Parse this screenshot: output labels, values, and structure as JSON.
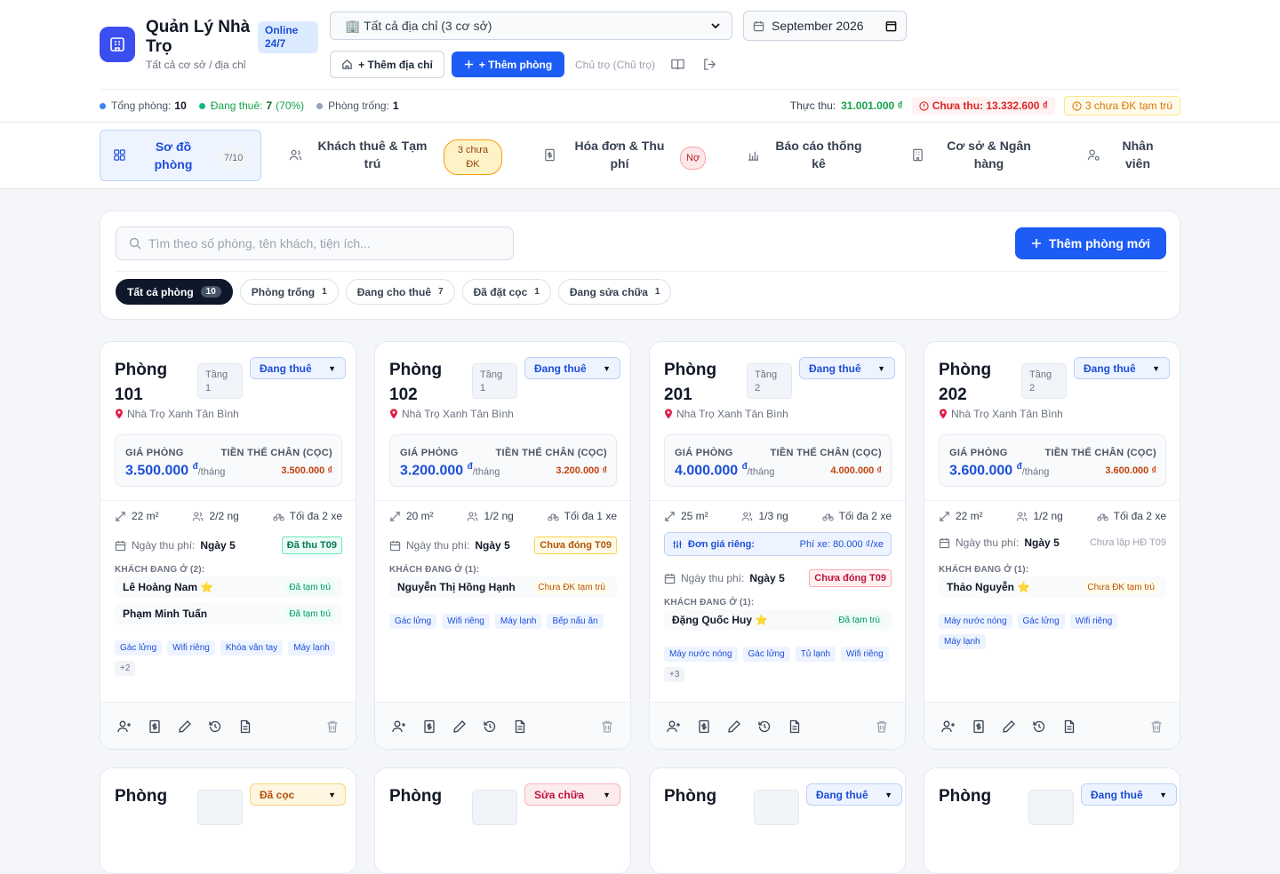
{
  "header": {
    "title": "Quản Lý Nhà Trọ",
    "subtitle": "Tất cả cơ sở / địa chỉ",
    "online_badge": "Online 24/7",
    "address_select": "🏢 Tất cả địa chỉ (3 cơ sở)",
    "month": "September 2026",
    "add_address_label": "+ Thêm địa chỉ",
    "add_room_label": "+ Thêm phòng",
    "owner": "Chủ trọ (Chủ trọ)"
  },
  "stats": {
    "total_label": "Tổng phòng:",
    "total_value": "10",
    "renting_label": "Đang thuê:",
    "renting_value": "7",
    "renting_pct": "(70%)",
    "empty_label": "Phòng trống:",
    "empty_value": "1",
    "collected_label": "Thực thu:",
    "collected_value": "31.001.000 ₫",
    "uncollected": "Chưa thu: 13.332.600 ₫",
    "unregistered": "3 chưa ĐK tạm trú",
    "colors": {
      "total": "#3b82f6",
      "renting": "#10b981",
      "empty": "#94a3b8"
    }
  },
  "tabs": [
    {
      "label": "Sơ đồ phòng",
      "count": "7/10",
      "icon": "grid-icon"
    },
    {
      "label": "Khách thuê & Tạm trú",
      "badge": "3 chưa ĐK",
      "icon": "users-icon"
    },
    {
      "label": "Hóa đơn & Thu phí",
      "badge": "Nợ",
      "icon": "invoice-icon"
    },
    {
      "label": "Báo cáo thống kê",
      "icon": "bar-chart-icon"
    },
    {
      "label": "Cơ sở & Ngân hàng",
      "icon": "building-icon"
    },
    {
      "label": "Nhân viên",
      "icon": "user-settings-icon"
    }
  ],
  "search": {
    "placeholder": "Tìm theo số phòng, tên khách, tiện ích..."
  },
  "new_room_button": "Thêm phòng mới",
  "filters": [
    {
      "label": "Tất cả phòng",
      "count": "10"
    },
    {
      "label": "Phòng trống",
      "count": "1"
    },
    {
      "label": "Đang cho thuê",
      "count": "7"
    },
    {
      "label": "Đã đặt cọc",
      "count": "1"
    },
    {
      "label": "Đang sửa chữa",
      "count": "1"
    }
  ],
  "labels": {
    "price": "GIÁ PHÒNG",
    "deposit": "TIỀN THẾ CHÂN (CỌC)",
    "per_month": "/tháng",
    "fee_day": "Ngày thu phí:",
    "special_price": "Đơn giá riêng:"
  },
  "rooms": [
    {
      "title": "Phòng 101",
      "floor": "Tầng 1",
      "status": "Đang thuê",
      "address": "Nhà Trọ Xanh Tân Bình",
      "price": "3.500.000",
      "currency": "đ",
      "deposit": "3.500.000 ₫",
      "area": "22 m²",
      "occupants": "2/2 ng",
      "vehicles": "Tối đa 2 xe",
      "fee_day": "Ngày 5",
      "fee_status": "Đã thu T09",
      "tenants_header": "KHÁCH ĐANG Ở (2):",
      "tenants": [
        {
          "name": "Lê Hoàng Nam ⭐",
          "tag": "Đã tạm trú"
        },
        {
          "name": "Phạm Minh Tuấn",
          "tag": "Đã tạm trú"
        }
      ],
      "amenities": [
        "Gác lửng",
        "Wifi riêng",
        "Khóa vân tay",
        "Máy lạnh",
        "+2"
      ]
    },
    {
      "title": "Phòng 102",
      "floor": "Tầng 1",
      "status": "Đang thuê",
      "address": "Nhà Trọ Xanh Tân Bình",
      "price": "3.200.000",
      "currency": "đ",
      "deposit": "3.200.000 ₫",
      "area": "20 m²",
      "occupants": "1/2 ng",
      "vehicles": "Tối đa 1 xe",
      "fee_day": "Ngày 5",
      "fee_status": "Chưa đóng T09",
      "tenants_header": "KHÁCH ĐANG Ở (1):",
      "tenants": [
        {
          "name": "Nguyễn Thị Hồng Hạnh",
          "tag": "Chưa ĐK tạm trú"
        }
      ],
      "amenities": [
        "Gác lửng",
        "Wifi riêng",
        "Máy lạnh",
        "Bếp nấu ăn"
      ]
    },
    {
      "title": "Phòng 201",
      "floor": "Tầng 2",
      "status": "Đang thuê",
      "address": "Nhà Trọ Xanh Tân Bình",
      "price": "4.000.000",
      "currency": "đ",
      "deposit": "4.000.000 ₫",
      "area": "25 m²",
      "occupants": "1/3 ng",
      "vehicles": "Tối đa 2 xe",
      "special_value": "Phí xe: 80.000 ₫/xe",
      "fee_day": "Ngày 5",
      "fee_status": "Chưa đóng T09",
      "tenants_header": "KHÁCH ĐANG Ở (1):",
      "tenants": [
        {
          "name": "Đặng Quốc Huy ⭐",
          "tag": "Đã tạm trú"
        }
      ],
      "amenities": [
        "Máy nước nóng",
        "Gác lửng",
        "Tủ lạnh",
        "Wifi riêng",
        "+3"
      ]
    },
    {
      "title": "Phòng 202",
      "floor": "Tầng 2",
      "status": "Đang thuê",
      "address": "Nhà Trọ Xanh Tân Bình",
      "price": "3.600.000",
      "currency": "đ",
      "deposit": "3.600.000 ₫",
      "area": "22 m²",
      "occupants": "1/2 ng",
      "vehicles": "Tối đa 2 xe",
      "fee_day": "Ngày 5",
      "fee_status": "Chưa lập HĐ T09",
      "tenants_header": "KHÁCH ĐANG Ở (1):",
      "tenants": [
        {
          "name": "Thảo Nguyễn ⭐",
          "tag": "Chưa ĐK tạm trú"
        }
      ],
      "amenities": [
        "Máy nước nóng",
        "Gác lửng",
        "Wifi riêng",
        "Máy lạnh"
      ]
    }
  ],
  "rooms_row2": [
    {
      "title": "Phòng",
      "status": "Đã cọc"
    },
    {
      "title": "Phòng",
      "status": "Sửa chữa"
    },
    {
      "title": "Phòng",
      "status": "Đang thuê"
    },
    {
      "title": "Phòng",
      "status": "Đang thuê"
    }
  ]
}
